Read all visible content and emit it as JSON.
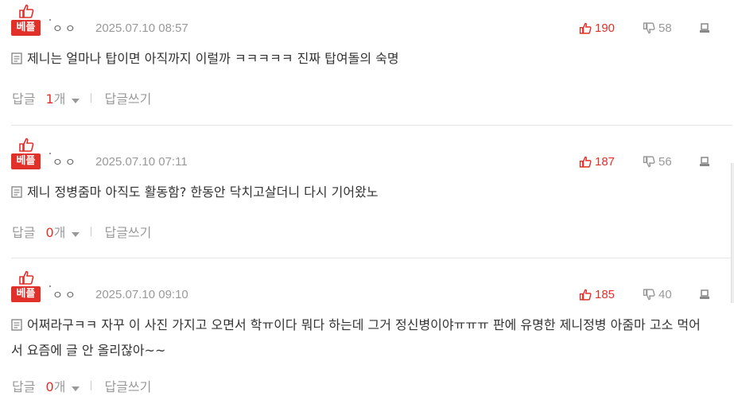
{
  "badge_label": "베플",
  "author_mask": "ㅇㅇ",
  "reply_label": "답글",
  "reply_count_suffix": "개",
  "write_reply_label": "답글쓰기",
  "accent_color": "#e1302a",
  "icons": {
    "best": "thumbs-up-icon",
    "like": "thumbs-up-icon",
    "dislike": "thumbs-down-icon",
    "report": "report-icon",
    "memo": "memo-icon",
    "expand": "chevron-down-icon"
  },
  "comments": [
    {
      "date": "2025.07.10 08:57",
      "likes": "190",
      "dislikes": "58",
      "text": "제니는 얼마나 탑이면 아직까지 이럴까 ㅋㅋㅋㅋㅋ 진짜 탑여돌의 숙명",
      "reply_count": "1"
    },
    {
      "date": "2025.07.10 07:11",
      "likes": "187",
      "dislikes": "56",
      "text": "제니 정병줌마 아직도 활동함? 한동안 닥치고살더니 다시 기어왔노",
      "reply_count": "0"
    },
    {
      "date": "2025.07.10 09:10",
      "likes": "185",
      "dislikes": "40",
      "text": "어쩌라구ㅋㅋ 자꾸 이 사진 가지고 오면서 학ㅠ이다 뭐다 하는데 그거 정신병이야ㅠㅠㅠ 판에 유명한 제니정병 아줌마 고소 먹어서 요즘에 글 안 올리잖아~~",
      "reply_count": "0"
    }
  ]
}
